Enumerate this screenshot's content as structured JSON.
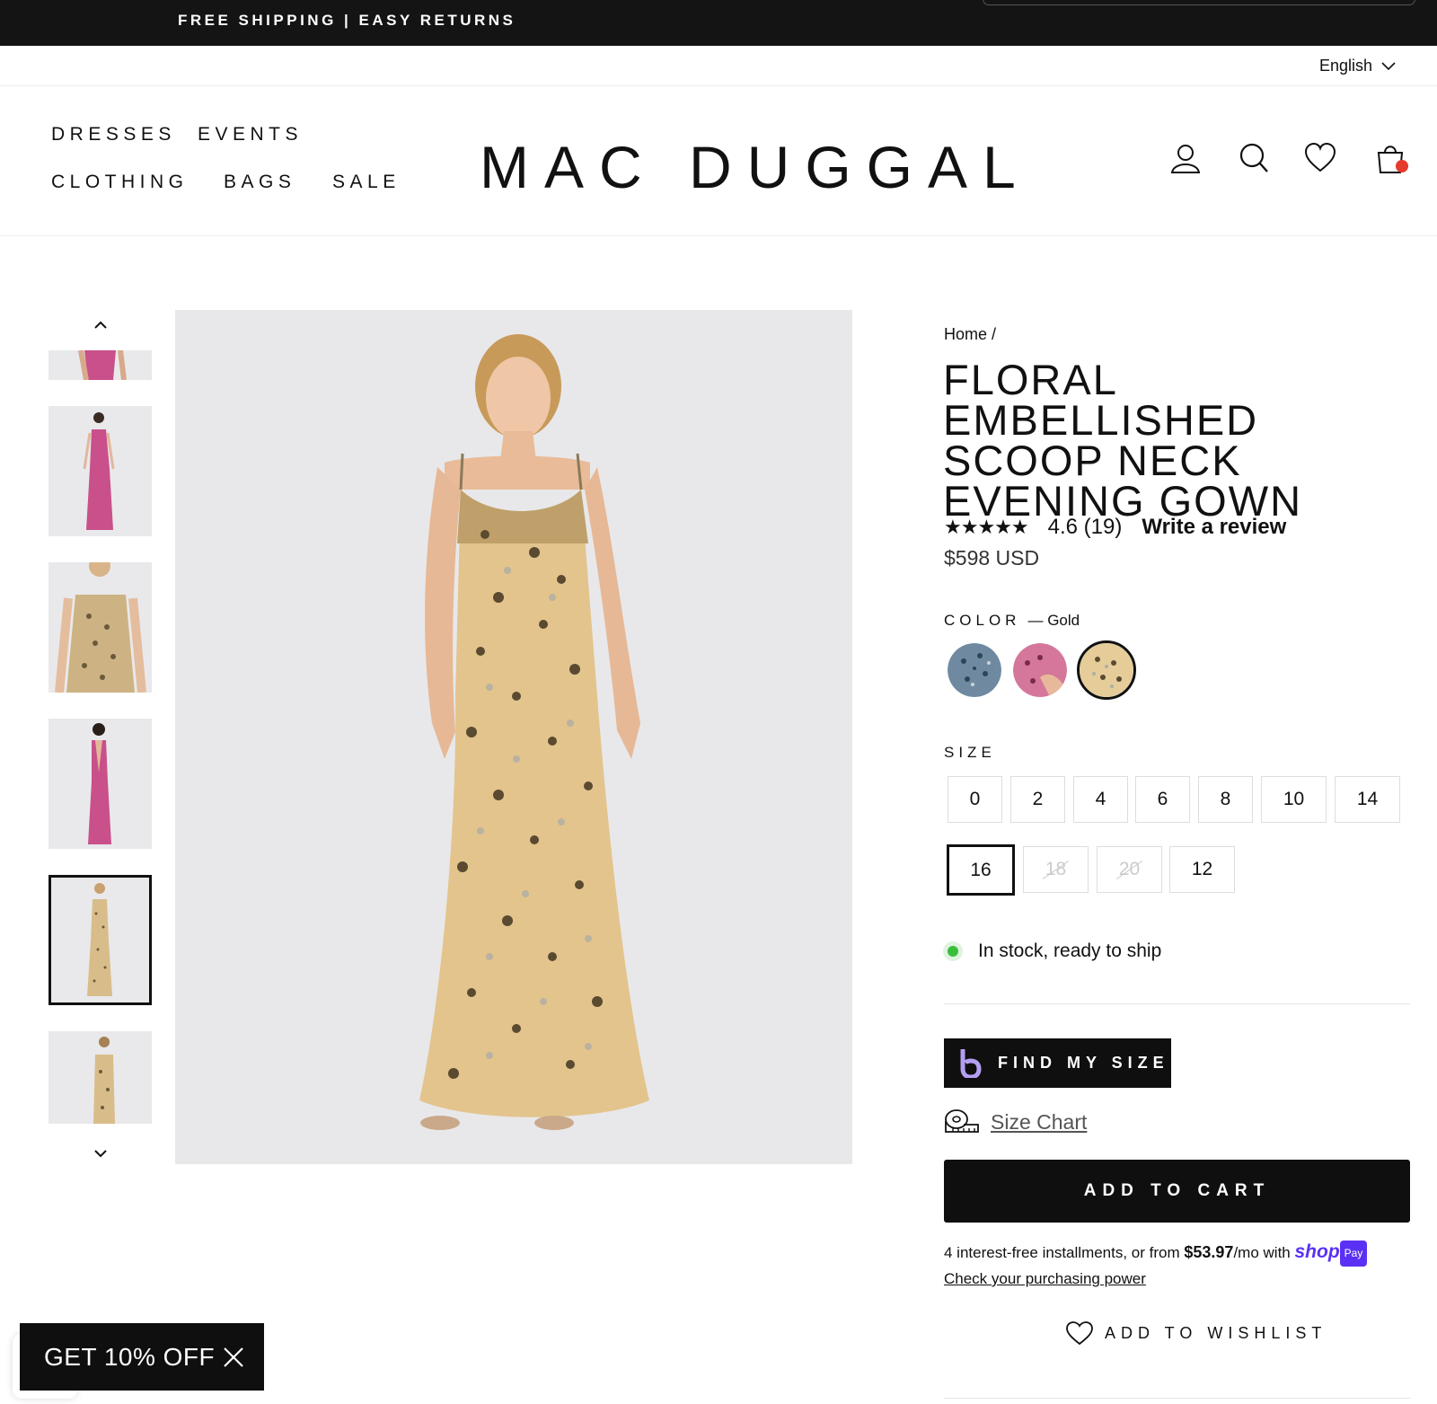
{
  "promo": {
    "text": "FREE SHIPPING  |  EASY RETURNS"
  },
  "language": {
    "selected": "English"
  },
  "nav": {
    "dresses": "DRESSES",
    "events": "EVENTS",
    "clothing": "CLOTHING",
    "bags": "BAGS",
    "sale": "SALE"
  },
  "logo": "MAC DUGGAL",
  "header_icons": [
    "account-icon",
    "search-icon",
    "heart-icon",
    "bag-icon"
  ],
  "thumbnails": [
    {
      "color": "pink"
    },
    {
      "color": "pink"
    },
    {
      "color": "gold"
    },
    {
      "color": "pink"
    },
    {
      "color": "gold",
      "active": true
    },
    {
      "color": "gold"
    }
  ],
  "breadcrumb": {
    "home": "Home",
    "separator": "/"
  },
  "product": {
    "title": "FLORAL EMBELLISHED SCOOP NECK EVENING GOWN",
    "stars": "★★★★★",
    "rating": "4.6 (19)",
    "write_review": "Write a review",
    "price": "$598 USD"
  },
  "color": {
    "label": "COLOR",
    "selected": "— Gold",
    "swatches": [
      {
        "name": "Blue",
        "hex": "#6f8aa0"
      },
      {
        "name": "Pink",
        "hex": "#d4779a"
      },
      {
        "name": "Gold",
        "hex": "#e6cc98",
        "active": true
      }
    ]
  },
  "size": {
    "label": "SIZE",
    "options": [
      {
        "value": "0"
      },
      {
        "value": "2"
      },
      {
        "value": "4"
      },
      {
        "value": "6"
      },
      {
        "value": "8"
      },
      {
        "value": "10"
      },
      {
        "value": "14"
      },
      {
        "value": "16",
        "active": true
      },
      {
        "value": "18",
        "available": false
      },
      {
        "value": "20",
        "available": false
      },
      {
        "value": "12"
      }
    ]
  },
  "stock": {
    "text": "In stock, ready to ship",
    "status_color": "#3bbf3b"
  },
  "find_my_size": "FIND MY SIZE",
  "size_chart": "Size Chart",
  "add_to_cart": "ADD TO CART",
  "installments": {
    "prefix": "4 interest-free installments, or from",
    "amount": "$53.97",
    "suffix": "/mo with",
    "shop": "shop",
    "pay": "Pay",
    "check_link": "Check your purchasing power"
  },
  "wishlist": "ADD TO WISHLIST",
  "discount": {
    "text": "GET 10% OFF"
  },
  "colors": {
    "accent": "#0f0f0f",
    "shop_pay": "#5a31f4",
    "cart_badge": "#e53a2c"
  }
}
